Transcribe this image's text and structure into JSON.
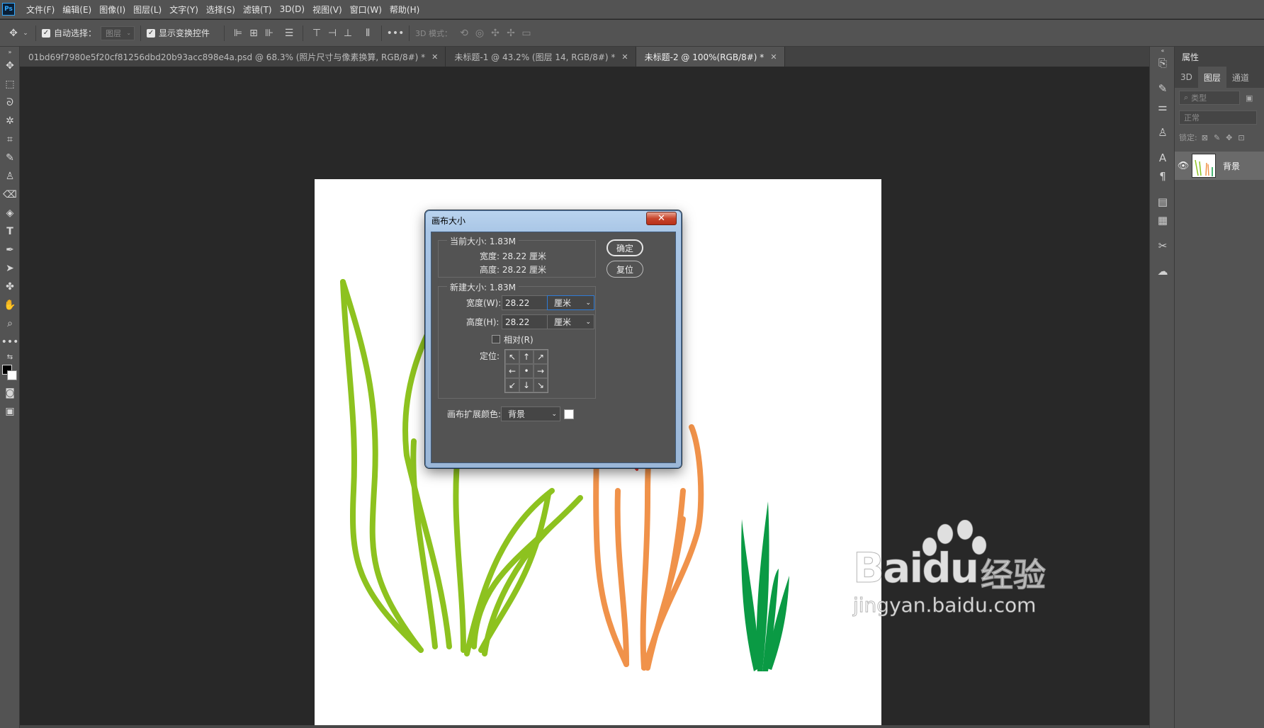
{
  "app": {
    "logo": "Ps"
  },
  "menu": [
    "文件(F)",
    "编辑(E)",
    "图像(I)",
    "图层(L)",
    "文字(Y)",
    "选择(S)",
    "滤镜(T)",
    "3D(D)",
    "视图(V)",
    "窗口(W)",
    "帮助(H)"
  ],
  "options": {
    "auto_select_label": "自动选择：",
    "auto_select_target": "图层",
    "show_transform_label": "显示变换控件",
    "mode_3d_label": "3D 模式："
  },
  "tabs": [
    {
      "title": "01bd69f7980e5f20cf81256dbd20b93acc898e4a.psd @ 68.3% (照片尺寸与像素换算, RGB/8#) *",
      "active": false
    },
    {
      "title": "未标题-1 @ 43.2% (图层 14, RGB/8#) *",
      "active": false
    },
    {
      "title": "未标题-2 @ 100%(RGB/8#) *",
      "active": true
    }
  ],
  "dialog": {
    "title": "画布大小",
    "current_size_label": "当前大小: 1.83M",
    "current_width": "宽度:  28.22 厘米",
    "current_height": "高度:  28.22 厘米",
    "new_size_label": "新建大小: 1.83M",
    "width_label": "宽度(W):",
    "width_value": "28.22",
    "width_unit": "厘米",
    "height_label": "高度(H):",
    "height_value": "28.22",
    "height_unit": "厘米",
    "relative_label": "相对(R)",
    "anchor_label": "定位:",
    "ext_color_label": "画布扩展颜色:",
    "ext_color_value": "背景",
    "ok_label": "确定",
    "reset_label": "复位",
    "anchor_arrows": [
      "↖",
      "↑",
      "↗",
      "←",
      "•",
      "→",
      "↙",
      "↓",
      "↘"
    ]
  },
  "panel": {
    "header": "属性",
    "tabs": [
      "3D",
      "图层",
      "通道"
    ],
    "active_tab": "图层",
    "search_placeholder": "类型",
    "blend_mode": "正常",
    "lock_label": "锁定:",
    "layer_name": "背景"
  },
  "watermark": {
    "brand": "Baidu",
    "cn": "经验",
    "url": "jingyan.baidu.com"
  },
  "colors": {
    "grass_green": "#8dc21f",
    "grass_orange": "#f0924a",
    "grass_dark": "#0a9a44",
    "arrow": "#e8382f"
  }
}
